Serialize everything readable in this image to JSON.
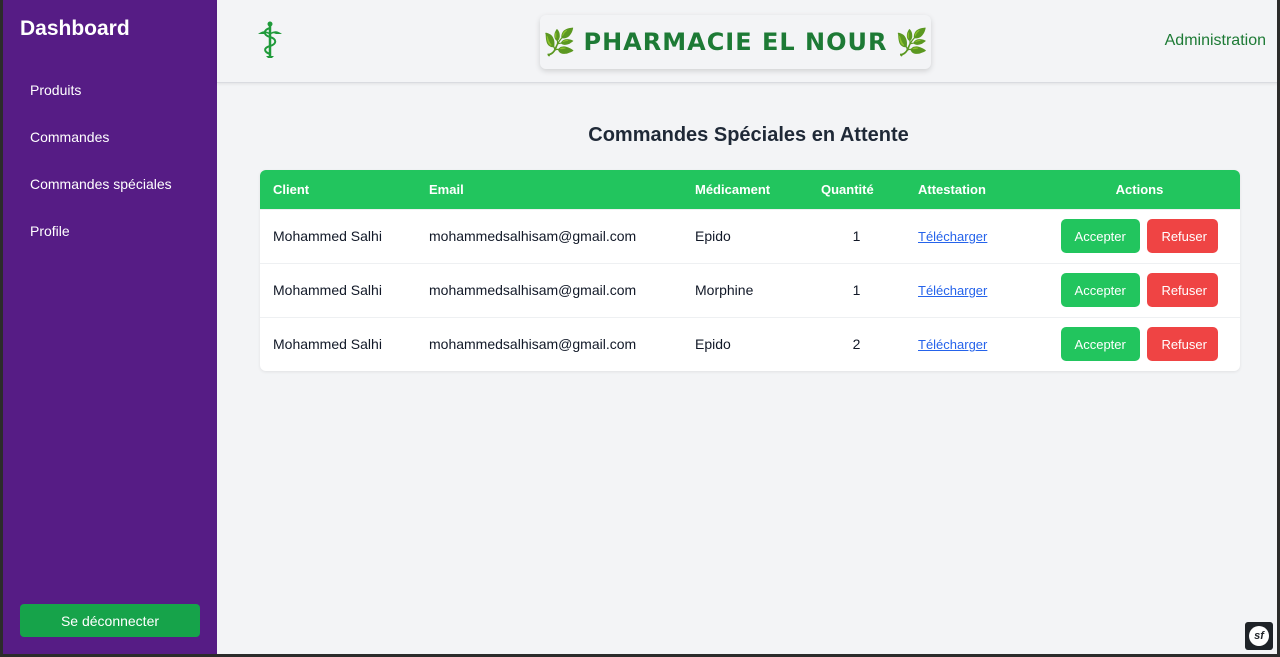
{
  "sidebar": {
    "brand": "Dashboard",
    "items": [
      {
        "label": "Produits"
      },
      {
        "label": "Commandes"
      },
      {
        "label": "Commandes spéciales"
      },
      {
        "label": "Profile"
      }
    ],
    "logout_label": "Se déconnecter"
  },
  "header": {
    "logo_icon": "caduceus-icon",
    "title": "PHARMACIE EL NOUR",
    "title_leaf": "🌿",
    "admin_link": "Administration"
  },
  "main": {
    "title": "Commandes Spéciales en Attente",
    "table": {
      "headers": [
        "Client",
        "Email",
        "Médicament",
        "Quantité",
        "Attestation",
        "Actions"
      ],
      "rows": [
        {
          "client": "Mohammed Salhi",
          "email": "mohammedsalhisam@gmail.com",
          "medicament": "Epido",
          "quantite": "1",
          "attestation": "Télécharger",
          "accept": "Accepter",
          "refuse": "Refuser"
        },
        {
          "client": "Mohammed Salhi",
          "email": "mohammedsalhisam@gmail.com",
          "medicament": "Morphine",
          "quantite": "1",
          "attestation": "Télécharger",
          "accept": "Accepter",
          "refuse": "Refuser"
        },
        {
          "client": "Mohammed Salhi",
          "email": "mohammedsalhisam@gmail.com",
          "medicament": "Epido",
          "quantite": "2",
          "attestation": "Télécharger",
          "accept": "Accepter",
          "refuse": "Refuser"
        }
      ]
    }
  },
  "debug_badge": "sf",
  "colors": {
    "sidebar": "#561c85",
    "accent_green": "#22c55e",
    "danger_red": "#ef4444",
    "brand_green": "#1d7a35"
  }
}
